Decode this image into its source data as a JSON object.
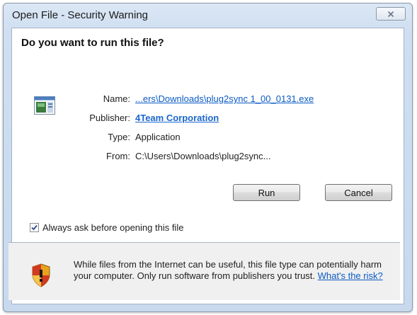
{
  "window": {
    "title": "Open File - Security Warning"
  },
  "prompt": {
    "question": "Do you want to run this file?"
  },
  "file_info": {
    "name_label": "Name:",
    "name_value": "...ers\\Downloads\\plug2sync 1_00_0131.exe",
    "publisher_label": "Publisher:",
    "publisher_value": "4Team Corporation",
    "type_label": "Type:",
    "type_value": "Application",
    "from_label": "From:",
    "from_value": "C:\\Users\\Downloads\\plug2sync..."
  },
  "buttons": {
    "run": "Run",
    "cancel": "Cancel"
  },
  "checkbox": {
    "label": "Always ask before opening this file",
    "checked": true
  },
  "warning": {
    "text": "While files from the Internet can be useful, this file type can potentially harm your computer. Only run software from publishers you trust.",
    "link": "What's the risk?"
  },
  "icons": {
    "close": "close-icon",
    "file": "application-file-icon",
    "shield": "security-shield-icon",
    "check": "checkmark-icon"
  },
  "colors": {
    "link": "#0a5bc4",
    "titlebar": "#dbe7f5",
    "warning_panel": "#f0f0f0"
  }
}
